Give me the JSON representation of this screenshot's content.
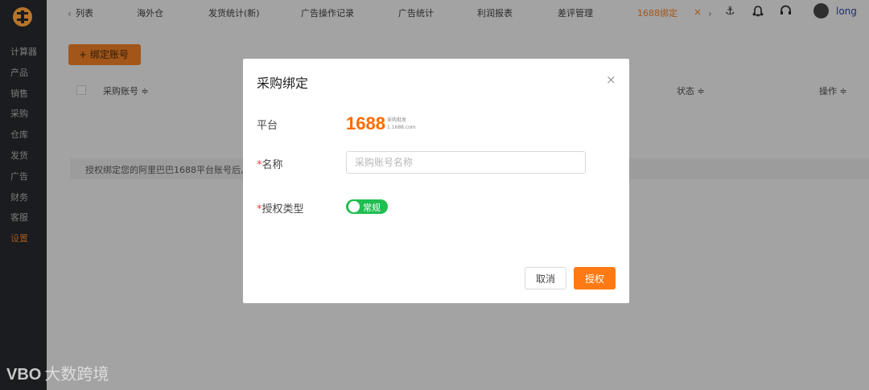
{
  "sidebar": {
    "items": [
      {
        "label": "计算器"
      },
      {
        "label": "产品"
      },
      {
        "label": "销售"
      },
      {
        "label": "采购"
      },
      {
        "label": "仓库"
      },
      {
        "label": "发货"
      },
      {
        "label": "广告"
      },
      {
        "label": "财务"
      },
      {
        "label": "客服"
      },
      {
        "label": "设置",
        "active": true
      }
    ]
  },
  "topbar": {
    "tabs": [
      {
        "label": "列表"
      },
      {
        "label": "海外仓"
      },
      {
        "label": "发货统计(新)"
      },
      {
        "label": "广告操作记录"
      },
      {
        "label": "广告统计"
      },
      {
        "label": "利润报表"
      },
      {
        "label": "差评管理"
      },
      {
        "label": "1688绑定",
        "active": true
      }
    ],
    "close_glyph": "×",
    "user_name": "long"
  },
  "page": {
    "bind_button": "+ 绑定账号",
    "columns": {
      "purchase_account": "采购账号 ≑",
      "status": "状态 ≑",
      "action": "操作 ≑"
    },
    "tip": "授权绑定您的阿里巴巴1688平台账号后,"
  },
  "modal": {
    "title": "采购绑定",
    "close": "×",
    "platform_label": "平台",
    "platform_logo": "1688",
    "platform_logo_sub1": "采购批发",
    "platform_logo_sub2": "1.1688.com",
    "name_label": "名称",
    "name_placeholder": "采购账号名称",
    "name_value": "",
    "auth_type_label": "授权类型",
    "auth_type_value": "常规",
    "cancel": "取消",
    "confirm": "授权"
  },
  "watermark": {
    "logo": "VBO",
    "text": "大数跨境"
  },
  "colors": {
    "accent": "#ff7a14",
    "switch_on": "#1fbf51",
    "required": "#f23c3c"
  }
}
